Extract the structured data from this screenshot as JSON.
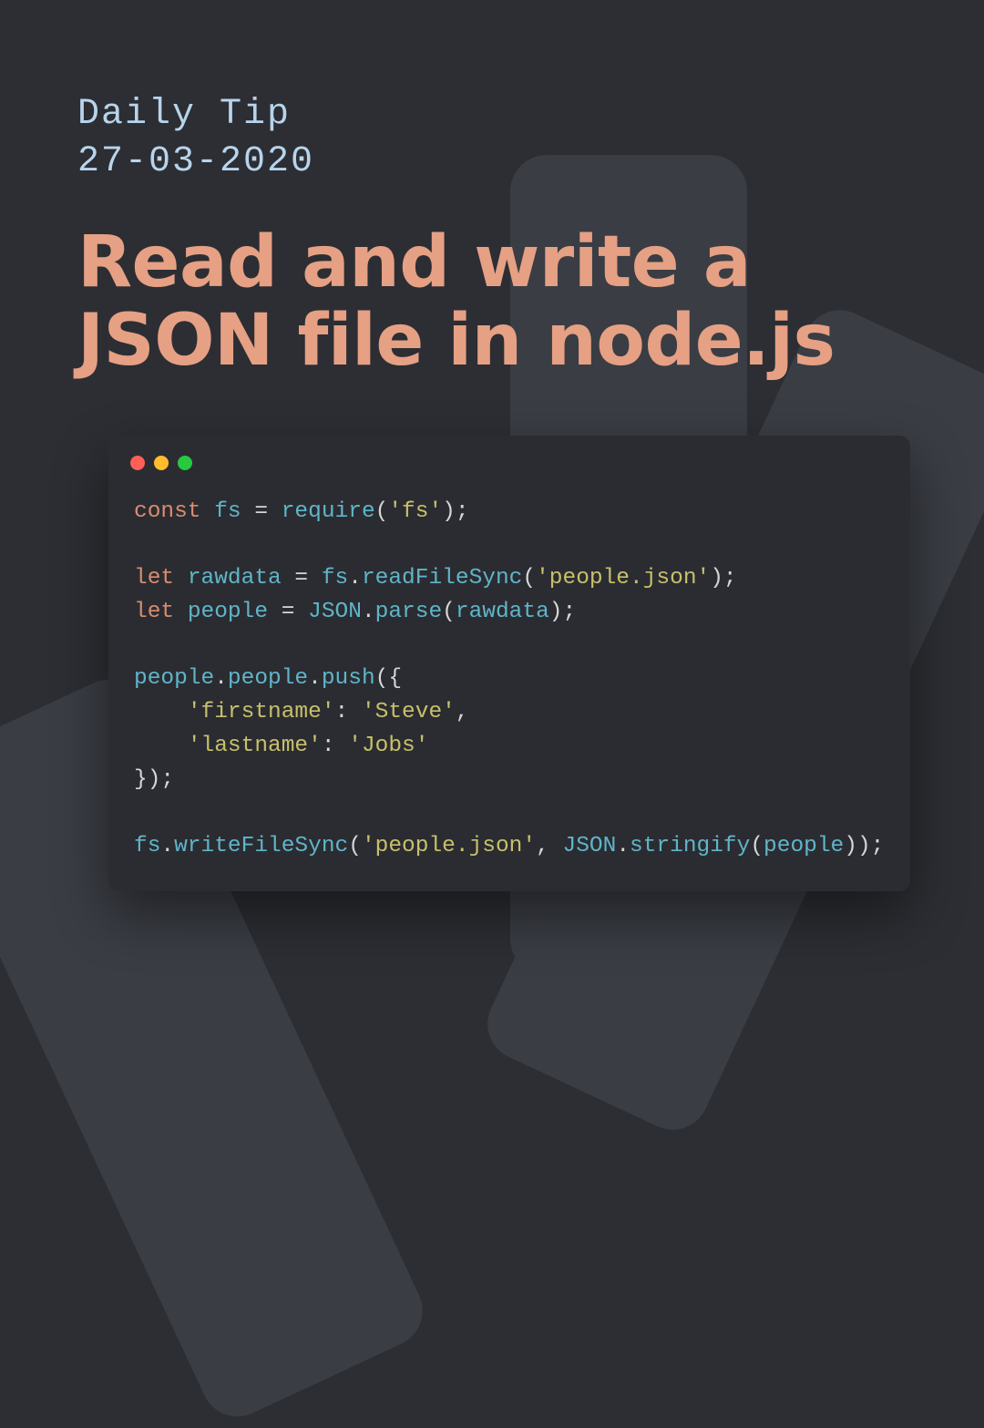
{
  "subtitle_line1": "Daily Tip",
  "subtitle_line2": "27-03-2020",
  "title": "Read and write a JSON file in node.js",
  "code": {
    "tokens": [
      [
        {
          "t": "const ",
          "c": "c-kw"
        },
        {
          "t": "fs",
          "c": "c-var"
        },
        {
          "t": " = ",
          "c": "c-op"
        },
        {
          "t": "require",
          "c": "c-fn"
        },
        {
          "t": "(",
          "c": "c-punc"
        },
        {
          "t": "'fs'",
          "c": "c-str"
        },
        {
          "t": ");",
          "c": "c-punc"
        }
      ],
      [],
      [
        {
          "t": "let ",
          "c": "c-kw"
        },
        {
          "t": "rawdata",
          "c": "c-var"
        },
        {
          "t": " = ",
          "c": "c-op"
        },
        {
          "t": "fs",
          "c": "c-var"
        },
        {
          "t": ".",
          "c": "c-punc"
        },
        {
          "t": "readFileSync",
          "c": "c-fn"
        },
        {
          "t": "(",
          "c": "c-punc"
        },
        {
          "t": "'people.json'",
          "c": "c-str"
        },
        {
          "t": ");",
          "c": "c-punc"
        }
      ],
      [
        {
          "t": "let ",
          "c": "c-kw"
        },
        {
          "t": "people",
          "c": "c-var"
        },
        {
          "t": " = ",
          "c": "c-op"
        },
        {
          "t": "JSON",
          "c": "c-var"
        },
        {
          "t": ".",
          "c": "c-punc"
        },
        {
          "t": "parse",
          "c": "c-fn"
        },
        {
          "t": "(",
          "c": "c-punc"
        },
        {
          "t": "rawdata",
          "c": "c-var"
        },
        {
          "t": ");",
          "c": "c-punc"
        }
      ],
      [],
      [
        {
          "t": "people",
          "c": "c-var"
        },
        {
          "t": ".",
          "c": "c-punc"
        },
        {
          "t": "people",
          "c": "c-var"
        },
        {
          "t": ".",
          "c": "c-punc"
        },
        {
          "t": "push",
          "c": "c-fn"
        },
        {
          "t": "({",
          "c": "c-punc"
        }
      ],
      [
        {
          "t": "    ",
          "c": "c-punc"
        },
        {
          "t": "'firstname'",
          "c": "c-str"
        },
        {
          "t": ": ",
          "c": "c-punc"
        },
        {
          "t": "'Steve'",
          "c": "c-str"
        },
        {
          "t": ",",
          "c": "c-punc"
        }
      ],
      [
        {
          "t": "    ",
          "c": "c-punc"
        },
        {
          "t": "'lastname'",
          "c": "c-str"
        },
        {
          "t": ": ",
          "c": "c-punc"
        },
        {
          "t": "'Jobs'",
          "c": "c-str"
        }
      ],
      [
        {
          "t": "});",
          "c": "c-punc"
        }
      ],
      [],
      [
        {
          "t": "fs",
          "c": "c-var"
        },
        {
          "t": ".",
          "c": "c-punc"
        },
        {
          "t": "writeFileSync",
          "c": "c-fn"
        },
        {
          "t": "(",
          "c": "c-punc"
        },
        {
          "t": "'people.json'",
          "c": "c-str"
        },
        {
          "t": ", ",
          "c": "c-punc"
        },
        {
          "t": "JSON",
          "c": "c-var"
        },
        {
          "t": ".",
          "c": "c-punc"
        },
        {
          "t": "stringify",
          "c": "c-fn"
        },
        {
          "t": "(",
          "c": "c-punc"
        },
        {
          "t": "people",
          "c": "c-var"
        },
        {
          "t": "));",
          "c": "c-punc"
        }
      ]
    ]
  }
}
